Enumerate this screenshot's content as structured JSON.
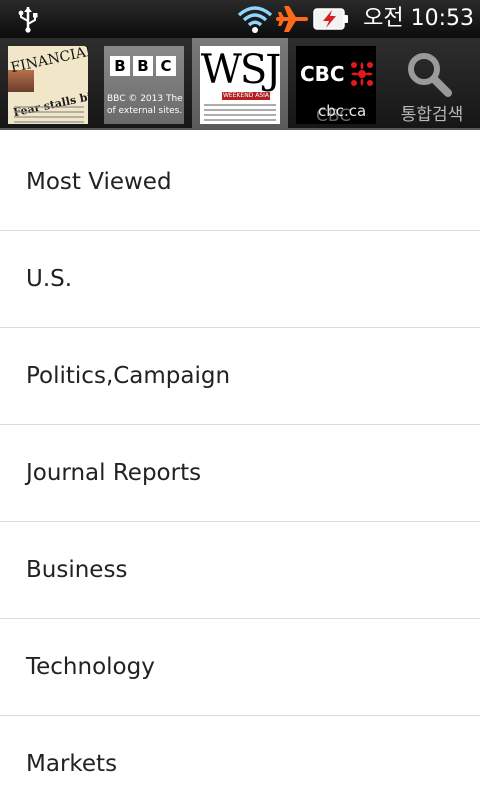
{
  "status_bar": {
    "time": "오전 10:53",
    "icons": [
      "usb-icon",
      "wifi-icon",
      "airplane-mode-icon",
      "battery-charging-icon"
    ]
  },
  "sources": [
    {
      "name": "Financial Times",
      "selected": false,
      "thumb": {
        "masthead": "FINANCIAL T",
        "headline": "Fear stalls big econom"
      }
    },
    {
      "name": "BBC",
      "selected": false,
      "thumb": {
        "letters": [
          "B",
          "B",
          "C"
        ],
        "caption1": "BBC © 2013 The",
        "caption2": "of external sites."
      }
    },
    {
      "name": "WSJ",
      "selected": true,
      "thumb": {
        "masthead": "WSJ",
        "edition": "WEEKEND ASIA"
      }
    },
    {
      "name": "CBC",
      "selected": false,
      "thumb": {
        "wordmark": "CBC",
        "domain": "cbc.ca",
        "label": "CBC"
      }
    },
    {
      "name": "search",
      "selected": false,
      "label": "통합검색"
    }
  ],
  "sections": [
    {
      "label": "Most Viewed"
    },
    {
      "label": "U.S."
    },
    {
      "label": "Politics,Campaign"
    },
    {
      "label": "Journal Reports"
    },
    {
      "label": "Business"
    },
    {
      "label": "Technology"
    },
    {
      "label": "Markets"
    }
  ],
  "colors": {
    "status_bar": "#111111",
    "selected_tab": "#6a6a6a",
    "divider": "#dcdcdc",
    "text": "#222222",
    "airplane": "#ff6a1a",
    "battery_bolt": "#d42020",
    "cbc_gem": "#e21a1a"
  }
}
